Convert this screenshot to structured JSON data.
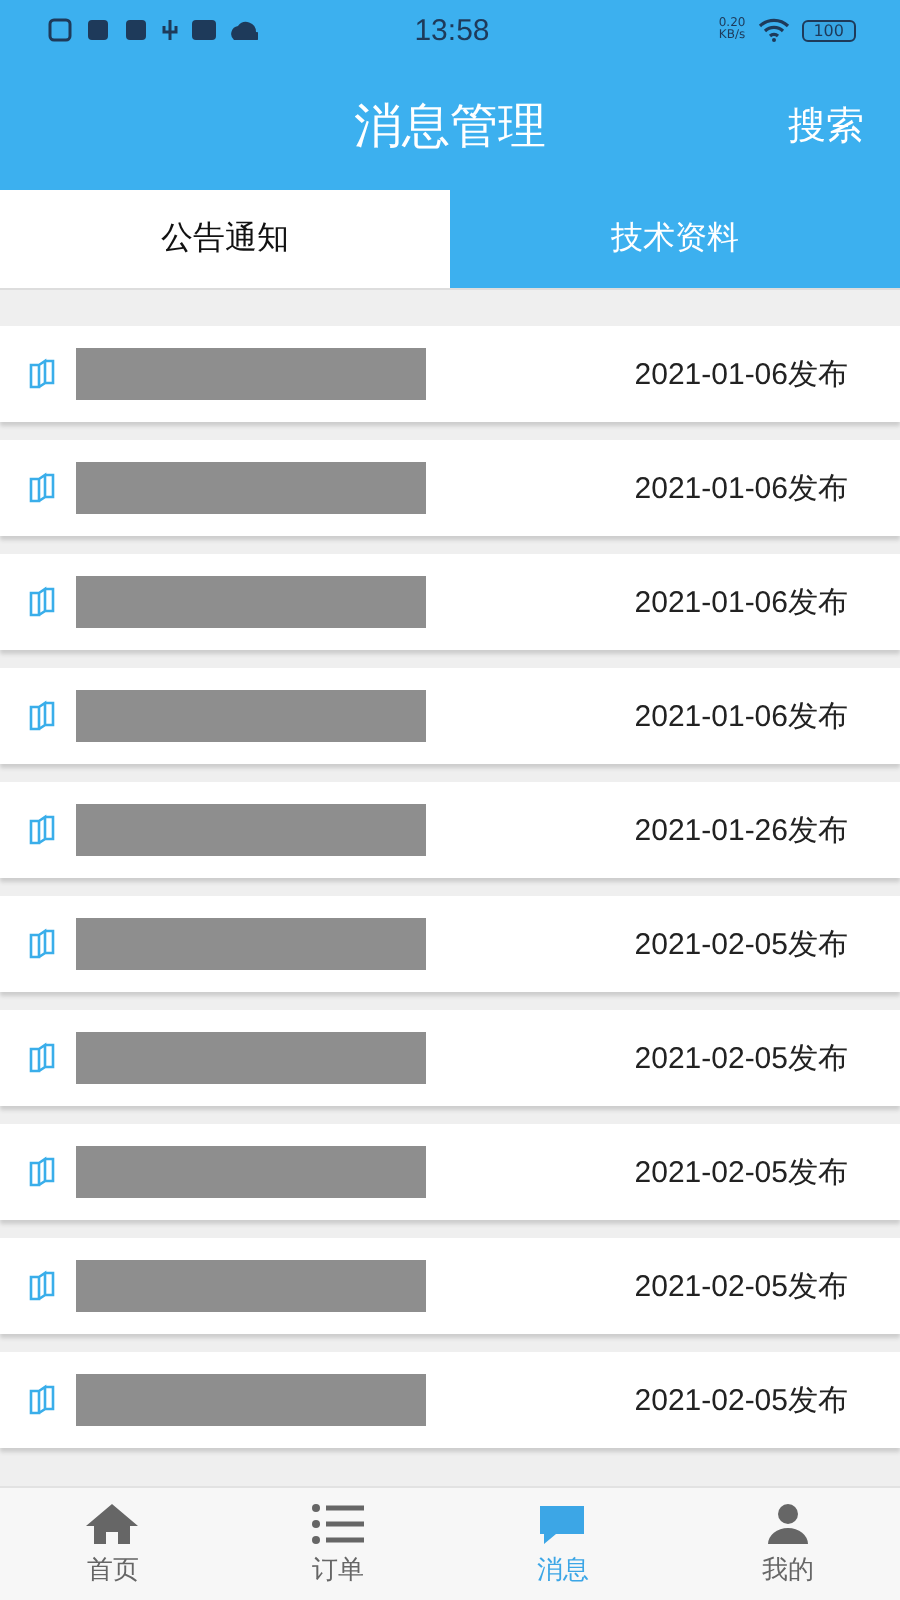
{
  "status_bar": {
    "time": "13:58",
    "net_speed": "0.20",
    "net_unit": "KB/s",
    "battery": "100"
  },
  "header": {
    "title": "消息管理",
    "action": "搜索"
  },
  "tabs": [
    {
      "label": "公告通知",
      "selected": false
    },
    {
      "label": "技术资料",
      "selected": true
    }
  ],
  "items": [
    {
      "date": "2021-01-06发布"
    },
    {
      "date": "2021-01-06发布"
    },
    {
      "date": "2021-01-06发布"
    },
    {
      "date": "2021-01-06发布"
    },
    {
      "date": "2021-01-26发布"
    },
    {
      "date": "2021-02-05发布"
    },
    {
      "date": "2021-02-05发布"
    },
    {
      "date": "2021-02-05发布"
    },
    {
      "date": "2021-02-05发布"
    },
    {
      "date": "2021-02-05发布"
    }
  ],
  "bottom_nav": [
    {
      "label": "首页",
      "kind": "home",
      "selected": false
    },
    {
      "label": "订单",
      "kind": "list",
      "selected": false
    },
    {
      "label": "消息",
      "kind": "message",
      "selected": true
    },
    {
      "label": "我的",
      "kind": "user",
      "selected": false
    }
  ]
}
